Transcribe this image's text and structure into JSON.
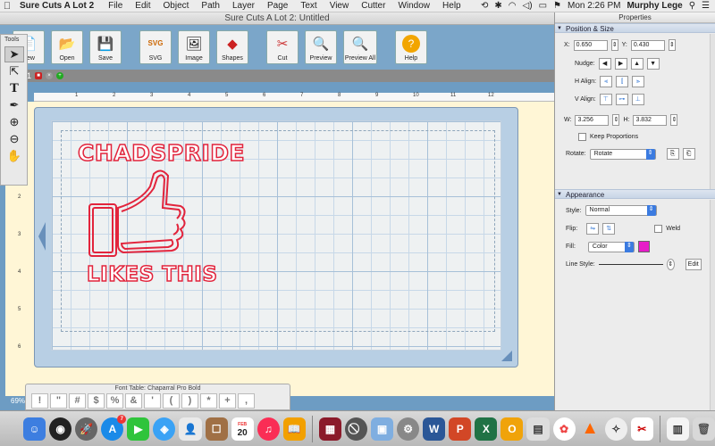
{
  "menubar": {
    "app_name": "Sure Cuts A Lot 2",
    "menus": [
      "File",
      "Edit",
      "Object",
      "Path",
      "Layer",
      "Page",
      "Text",
      "View",
      "Cutter",
      "Window",
      "Help"
    ],
    "clock": "Mon 2:26 PM",
    "user": "Murphy Lege",
    "wifi_icon": "wifi-icon",
    "bluetooth_icon": "bluetooth-icon"
  },
  "window": {
    "title": "Sure Cuts A Lot 2: Untitled"
  },
  "toolbar": {
    "buttons": [
      {
        "label": "New",
        "icon": "new-icon"
      },
      {
        "label": "Open",
        "icon": "open-icon"
      },
      {
        "label": "Save",
        "icon": "save-icon"
      },
      {
        "label": "SVG",
        "icon": "svg-icon"
      },
      {
        "label": "Image",
        "icon": "image-icon"
      },
      {
        "label": "Shapes",
        "icon": "shapes-icon"
      },
      {
        "label": "Cut",
        "icon": "scissors-icon"
      },
      {
        "label": "Preview",
        "icon": "preview-icon"
      },
      {
        "label": "Preview All",
        "icon": "preview-all-icon"
      },
      {
        "label": "Help",
        "icon": "help-icon"
      }
    ]
  },
  "tabs": {
    "page_number": "1"
  },
  "tools": {
    "header": "Tools",
    "items": [
      "select-arrow-icon",
      "node-edit-icon",
      "text-tool-icon",
      "pen-tool-icon",
      "zoom-in-icon",
      "zoom-out-icon",
      "hand-tool-icon"
    ]
  },
  "ruler": {
    "top": [
      "1",
      "2",
      "3",
      "4",
      "5",
      "6",
      "7",
      "8",
      "9",
      "10",
      "11",
      "12"
    ],
    "left": [
      "1",
      "2",
      "3",
      "4",
      "5",
      "6"
    ]
  },
  "design": {
    "top_text": "CHADSPRIDE",
    "bottom_text": "LIKES THIS",
    "stroke_color": "#e2243c"
  },
  "zoom_level": "69%",
  "font_table": {
    "title": "Font Table: Chaparral Pro Bold",
    "glyphs": [
      "!",
      "\"",
      "#",
      "$",
      "%",
      "&",
      "'",
      "(",
      ")",
      "*",
      "+",
      ","
    ]
  },
  "properties": {
    "title": "Properties",
    "position_size": {
      "header": "Position & Size",
      "x_label": "X:",
      "x_value": "0.650",
      "y_label": "Y:",
      "y_value": "0.430",
      "nudge_label": "Nudge:",
      "h_align_label": "H Align:",
      "v_align_label": "V Align:",
      "w_label": "W:",
      "w_value": "3.256",
      "h_label": "H:",
      "h_value": "3.832",
      "keep_proportions": "Keep Proportions",
      "rotate_label": "Rotate:",
      "rotate_value": "Rotate"
    },
    "appearance": {
      "header": "Appearance",
      "style_label": "Style:",
      "style_value": "Normal",
      "flip_label": "Flip:",
      "weld_label": "Weld",
      "fill_label": "Fill:",
      "fill_value": "Color",
      "fill_swatch": "#e61cc8",
      "line_style_label": "Line Style:",
      "edit_label": "Edit"
    }
  },
  "dock": {
    "mail_badge": "7",
    "calendar_month": "FEB",
    "calendar_day": "20"
  }
}
